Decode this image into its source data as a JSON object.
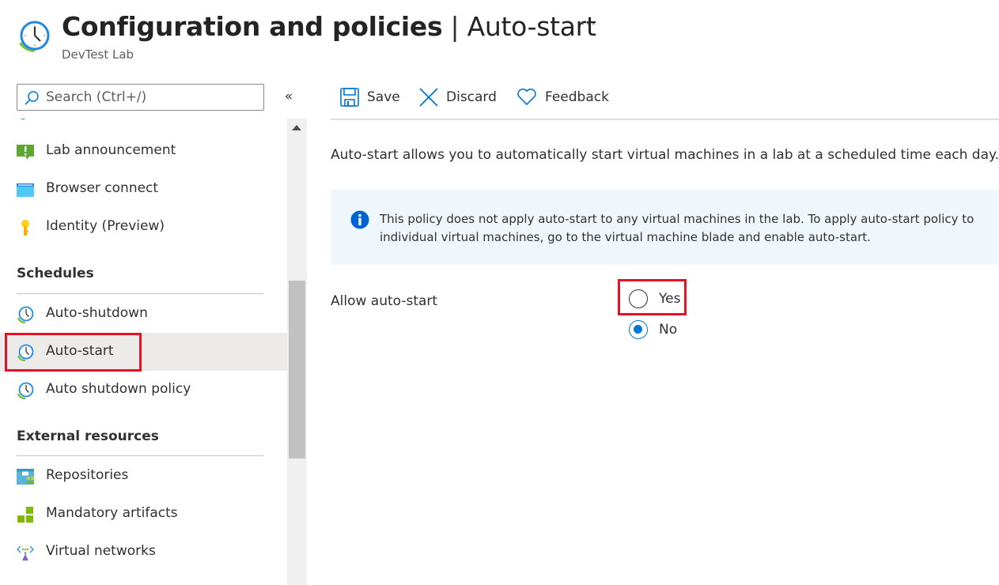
{
  "header": {
    "title_main": "Configuration and policies",
    "title_separator": "|",
    "title_section": "Auto-start",
    "subtitle": "DevTest Lab",
    "more_label": "···"
  },
  "sidebar": {
    "search_placeholder": "Search (Ctrl+/)",
    "collapse_label": "«",
    "items_top": [
      {
        "label": "Lab announcement",
        "icon": "lab-announcement-icon"
      },
      {
        "label": "Browser connect",
        "icon": "browser-connect-icon"
      },
      {
        "label": "Identity (Preview)",
        "icon": "key-icon"
      }
    ],
    "sections": [
      {
        "title": "Schedules",
        "items": [
          {
            "label": "Auto-shutdown",
            "icon": "clock-icon",
            "selected": false
          },
          {
            "label": "Auto-start",
            "icon": "clock-icon",
            "selected": true
          },
          {
            "label": "Auto shutdown policy",
            "icon": "clock-icon",
            "selected": false
          }
        ]
      },
      {
        "title": "External resources",
        "items": [
          {
            "label": "Repositories",
            "icon": "repositories-icon"
          },
          {
            "label": "Mandatory artifacts",
            "icon": "artifacts-icon"
          },
          {
            "label": "Virtual networks",
            "icon": "virtual-network-icon"
          }
        ]
      }
    ]
  },
  "toolbar": {
    "save_label": "Save",
    "discard_label": "Discard",
    "feedback_label": "Feedback"
  },
  "content": {
    "description": "Auto-start allows you to automatically start virtual machines in a lab at a scheduled time each day.",
    "info_line1": "This policy does not apply auto-start to any virtual machines in the lab. To apply auto-start policy to",
    "info_line2": "individual virtual machines, go to the virtual machine blade and enable auto-start.",
    "allow_label": "Allow auto-start",
    "options": [
      {
        "label": "Yes",
        "checked": false
      },
      {
        "label": "No",
        "checked": true
      }
    ]
  },
  "colors": {
    "accent": "#0078d4",
    "highlight": "#e81123",
    "info_bg": "#eff6fc",
    "selected_bg": "#edebe9"
  }
}
